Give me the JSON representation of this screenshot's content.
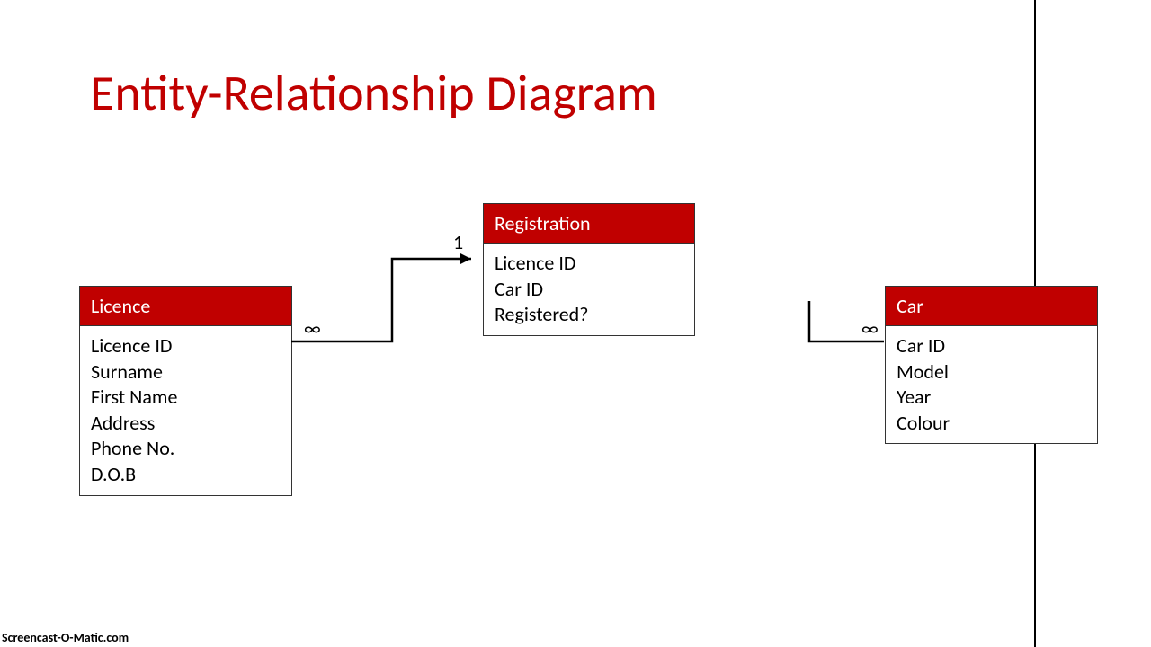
{
  "title": "Entity-Relationship Diagram",
  "entities": {
    "licence": {
      "name": "Licence",
      "attrs": [
        "Licence ID",
        "Surname",
        "First Name",
        "Address",
        "Phone No.",
        "D.O.B"
      ]
    },
    "registration": {
      "name": "Registration",
      "attrs": [
        "Licence ID",
        "Car ID",
        "Registered?"
      ]
    },
    "car": {
      "name": "Car",
      "attrs": [
        "Car ID",
        "Model",
        "Year",
        "Colour"
      ]
    }
  },
  "cardinality": {
    "licence_side": "∞",
    "registration_side": "1",
    "car_side": "∞"
  },
  "watermark": "Screencast-O-Matic.com"
}
